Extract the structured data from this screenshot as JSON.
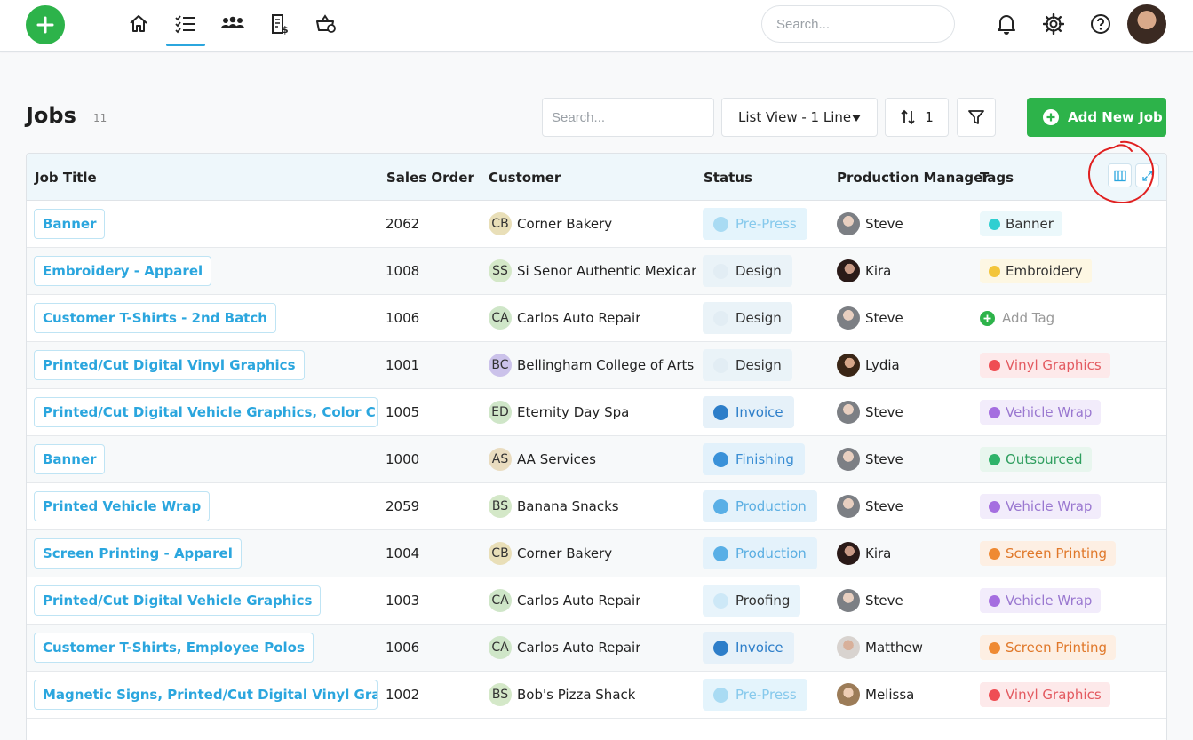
{
  "search": {
    "placeholder": "Search..."
  },
  "jobs": {
    "title": "Jobs",
    "count": "11",
    "search_placeholder": "Search...",
    "view_label": "List View - 1 Line",
    "sort_count": "1",
    "add_label": "Add New Job"
  },
  "columns": [
    "Job Title",
    "Sales Order",
    "Customer",
    "Status",
    "Production Manager",
    "Tags"
  ],
  "rows": [
    {
      "title": "Banner",
      "so": "2062",
      "initials": "CB",
      "customer": "Corner Bakery",
      "status": "Pre-Press",
      "manager": "Steve",
      "tag": "Banner"
    },
    {
      "title": "Embroidery - Apparel",
      "so": "1008",
      "initials": "SS",
      "customer": "Si Senor Authentic Mexican F",
      "status": "Design",
      "manager": "Kira",
      "tag": "Embroidery"
    },
    {
      "title": "Customer T-Shirts - 2nd Batch",
      "so": "1006",
      "initials": "CA",
      "customer": "Carlos Auto Repair",
      "status": "Design",
      "manager": "Steve",
      "tag": "Add Tag"
    },
    {
      "title": "Printed/Cut Digital Vinyl Graphics",
      "so": "1001",
      "initials": "BC",
      "customer": "Bellingham College of Arts",
      "status": "Design",
      "manager": "Lydia",
      "tag": "Vinyl Graphics"
    },
    {
      "title": "Printed/Cut Digital Vehicle Graphics, Color Change V",
      "so": "1005",
      "initials": "ED",
      "customer": "Eternity Day Spa",
      "status": "Invoice",
      "manager": "Steve",
      "tag": "Vehicle Wrap"
    },
    {
      "title": "Banner",
      "so": "1000",
      "initials": "AS",
      "customer": "AA Services",
      "status": "Finishing",
      "manager": "Steve",
      "tag": "Outsourced"
    },
    {
      "title": "Printed Vehicle Wrap",
      "so": "2059",
      "initials": "BS",
      "customer": "Banana Snacks",
      "status": "Production",
      "manager": "Steve",
      "tag": "Vehicle Wrap"
    },
    {
      "title": "Screen Printing - Apparel",
      "so": "1004",
      "initials": "CB",
      "customer": "Corner Bakery",
      "status": "Production",
      "manager": "Kira",
      "tag": "Screen Printing"
    },
    {
      "title": "Printed/Cut Digital Vehicle Graphics",
      "so": "1003",
      "initials": "CA",
      "customer": "Carlos Auto Repair",
      "status": "Proofing",
      "manager": "Steve",
      "tag": "Vehicle Wrap"
    },
    {
      "title": "Customer T-Shirts, Employee Polos",
      "so": "1006",
      "initials": "CA",
      "customer": "Carlos Auto Repair",
      "status": "Invoice",
      "manager": "Matthew",
      "tag": "Screen Printing"
    },
    {
      "title": "Magnetic Signs, Printed/Cut Digital Vinyl Graphics",
      "so": "1002",
      "initials": "BS",
      "customer": "Bob's Pizza Shack",
      "status": "Pre-Press",
      "manager": "Melissa",
      "tag": "Vinyl Graphics"
    }
  ],
  "colors": {
    "accent": "#2ba6de",
    "add_green": "#2db34a",
    "annotation": "#e02020"
  }
}
